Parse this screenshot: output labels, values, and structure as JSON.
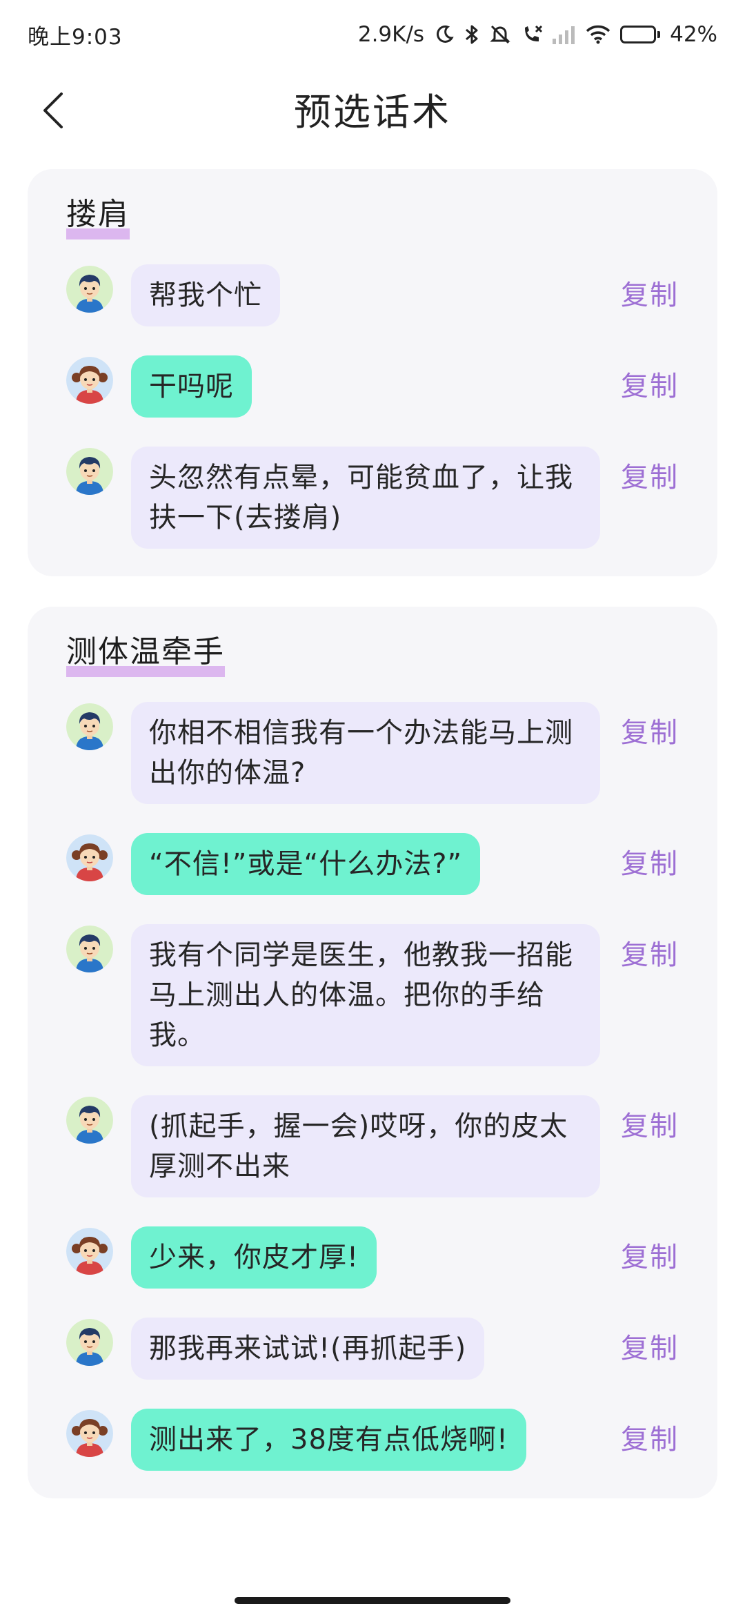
{
  "status_bar": {
    "time": "晚上9:03",
    "network_speed": "2.9K/s",
    "battery": "42%",
    "battery_level": 0.42
  },
  "header": {
    "title": "预选话术"
  },
  "colors": {
    "male_bubble": "#ece9fb",
    "female_bubble": "#6ff2d0",
    "copy_text": "#9d6fd4",
    "underline": "#dcb7ef",
    "card_bg": "#f6f6f9"
  },
  "copy_label": "复制",
  "sections": [
    {
      "title": "搂肩",
      "lines": [
        {
          "speaker": "male",
          "text": "帮我个忙"
        },
        {
          "speaker": "female",
          "text": "干吗呢"
        },
        {
          "speaker": "male",
          "text": "头忽然有点晕，可能贫血了，让我扶一下(去搂肩)"
        }
      ]
    },
    {
      "title": "测体温牵手",
      "lines": [
        {
          "speaker": "male",
          "text": "你相不相信我有一个办法能马上测出你的体温?"
        },
        {
          "speaker": "female",
          "text": "“不信!”或是“什么办法?”"
        },
        {
          "speaker": "male",
          "text": "我有个同学是医生，他教我一招能马上测出人的体温。把你的手给我。"
        },
        {
          "speaker": "male",
          "text": "(抓起手，握一会)哎呀，你的皮太厚测不出来"
        },
        {
          "speaker": "female",
          "text": "少来，你皮才厚!"
        },
        {
          "speaker": "male",
          "text": "那我再来试试!(再抓起手)"
        },
        {
          "speaker": "female",
          "text": "测出来了，38度有点低烧啊!"
        }
      ]
    }
  ]
}
